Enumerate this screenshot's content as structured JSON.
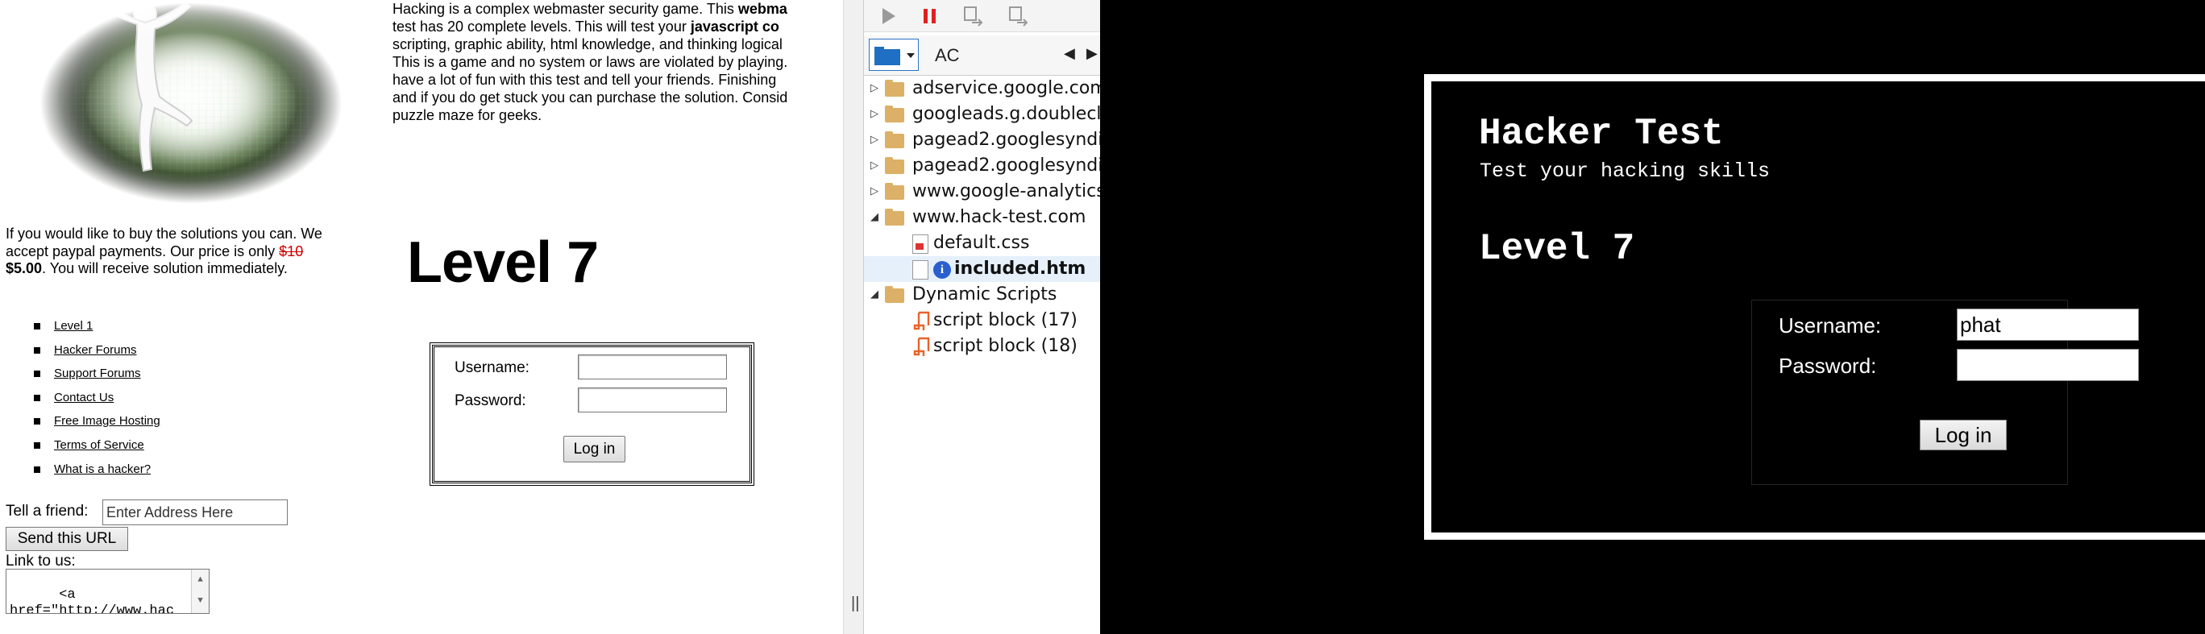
{
  "site": {
    "intro_lines": [
      {
        "pre": "Hacking is a complex webmaster security game. This ",
        "bold": "webma",
        "post": ""
      },
      {
        "pre": "test has 20 complete levels. This will test your ",
        "bold": "javascript co",
        "post": ""
      },
      {
        "pre": "scripting, graphic ability, html knowledge, and thinking logical",
        "bold": "",
        "post": ""
      },
      {
        "pre": "This is a game and no system or laws are violated by playing.",
        "bold": "",
        "post": ""
      },
      {
        "pre": "have a lot of fun with this test and tell your friends. Finishing",
        "bold": "",
        "post": ""
      },
      {
        "pre": "and if you do get stuck you can purchase the solution. Consid",
        "bold": "",
        "post": ""
      },
      {
        "pre": "puzzle maze for geeks.",
        "bold": "",
        "post": ""
      }
    ],
    "buy": {
      "line1": "If you would like to buy the solutions you can. We",
      "line2_pre": "accept paypal payments. Our price is only ",
      "old_price": "$10",
      "new_price": "$5.00",
      "line3_post": ". You will receive solution immediately."
    },
    "page_title": "Level 7",
    "nav_links": [
      "Level 1",
      "Hacker Forums",
      "Support Forums",
      "Contact Us",
      "Free Image Hosting",
      "Terms of Service",
      "What is a hacker?"
    ],
    "login": {
      "username_label": "Username:",
      "password_label": "Password:",
      "button": "Log in"
    },
    "tell_label": "Tell a friend:",
    "tell_placeholder": "Enter Address Here",
    "send_button": "Send this URL",
    "link_label": "Link to us:",
    "link_code": "<a\nhref=\"http://www.hac",
    "scroll_up": "▲",
    "scroll_down": "▼"
  },
  "devtools": {
    "tab_label": "AC",
    "prev_arrow": "◀",
    "next_arrow": "▶",
    "tree": [
      {
        "label": "adservice.google.com",
        "type": "folder",
        "expanded": false,
        "indent": 0
      },
      {
        "label": "googleads.g.doublecl",
        "type": "folder",
        "expanded": false,
        "indent": 0
      },
      {
        "label": "pagead2.googlesyndi",
        "type": "folder",
        "expanded": false,
        "indent": 0
      },
      {
        "label": "pagead2.googlesyndi",
        "type": "folder",
        "expanded": false,
        "indent": 0
      },
      {
        "label": "www.google-analytics",
        "type": "folder",
        "expanded": false,
        "indent": 0
      },
      {
        "label": "www.hack-test.com",
        "type": "folder",
        "expanded": true,
        "indent": 0
      },
      {
        "label": "default.css",
        "type": "css",
        "indent": 1
      },
      {
        "label": "included.htm",
        "type": "html-selected",
        "indent": 1
      },
      {
        "label": "Dynamic Scripts",
        "type": "folder",
        "expanded": true,
        "indent": 0
      },
      {
        "label": "script block (17)",
        "type": "script",
        "indent": 1
      },
      {
        "label": "script block (18)",
        "type": "script",
        "indent": 1
      }
    ],
    "collapsed_glyph": "▷",
    "expanded_glyph": "◢",
    "info_glyph": "i",
    "grip_glyph": "||"
  },
  "app": {
    "title": "Hacker Test",
    "subtitle": "Test your hacking skills",
    "level": "Level 7",
    "username_label": "Username:",
    "password_label": "Password:",
    "username_value": "phat",
    "password_value": "",
    "button": "Log in"
  },
  "colors": {
    "accent": "#2b73c7",
    "price_strike": "#cc0000",
    "dark_bg": "#000000",
    "pause_red": "#e02020"
  }
}
